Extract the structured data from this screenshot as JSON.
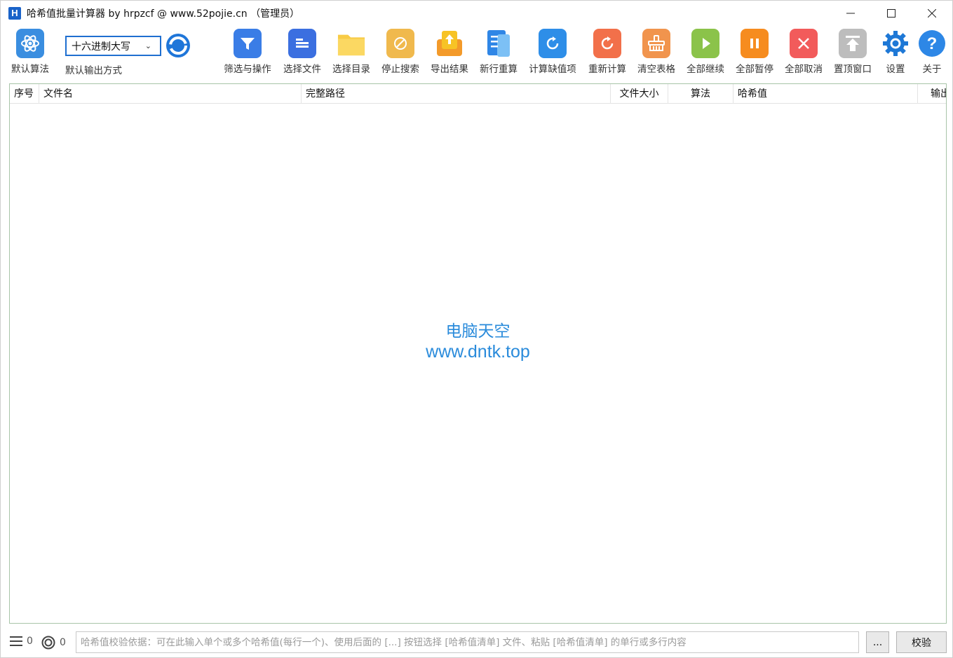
{
  "window": {
    "icon_letter": "H",
    "title": "哈希值批量计算器 by hrpzcf @ www.52pojie.cn （管理员）"
  },
  "toolbar": {
    "default_algorithm": {
      "label": "默认算法",
      "icon": "atom-icon",
      "color": "#3a8ee0"
    },
    "output_mode": {
      "value": "十六进制大写",
      "label": "默认输出方式"
    },
    "refresh": {
      "icon": "circular-refresh-icon",
      "color": "#1f76d9"
    },
    "buttons": [
      {
        "label": "筛选与操作",
        "icon": "filter-icon",
        "color": "#3a7de6"
      },
      {
        "label": "选择文件",
        "icon": "file-list-icon",
        "color": "#3b6fe0"
      },
      {
        "label": "选择目录",
        "icon": "folder-icon",
        "color": "#f8cb45"
      },
      {
        "label": "停止搜索",
        "icon": "stop-search-icon",
        "color": "#f0b94d"
      },
      {
        "label": "导出结果",
        "icon": "export-icon",
        "color": "#f7b825"
      },
      {
        "label": "新行重算",
        "icon": "new-row-recalc-icon",
        "color": "#2f86e6"
      },
      {
        "label": "计算缺值项",
        "icon": "calc-missing-icon",
        "color": "#2e8ee8"
      },
      {
        "label": "重新计算",
        "icon": "recalculate-icon",
        "color": "#f2704a"
      },
      {
        "label": "清空表格",
        "icon": "clear-table-icon",
        "color": "#f1944d"
      },
      {
        "label": "全部继续",
        "icon": "play-icon",
        "color": "#8bc34a"
      },
      {
        "label": "全部暂停",
        "icon": "pause-icon",
        "color": "#f68c1f"
      },
      {
        "label": "全部取消",
        "icon": "cancel-icon",
        "color": "#f25b5b"
      },
      {
        "label": "置顶窗口",
        "icon": "pin-top-icon",
        "color": "#bdbdbd"
      },
      {
        "label": "设置",
        "icon": "gear-icon",
        "color": "#1e78d6"
      },
      {
        "label": "关于",
        "icon": "help-icon",
        "color": "#2d87e6"
      }
    ]
  },
  "table": {
    "columns": [
      "序号",
      "文件名",
      "完整路径",
      "文件大小",
      "算法",
      "哈希值",
      "输出"
    ],
    "rows": []
  },
  "watermark": {
    "line1": "电脑天空",
    "line2": "www.dntk.top"
  },
  "status": {
    "list_count": "0",
    "target_count": "0",
    "verify_placeholder": "哈希值校验依据：可在此输入单个或多个哈希值(每行一个)、使用后面的 [...] 按钮选择 [哈希值清单] 文件、粘贴 [哈希值清单] 的单行或多行内容",
    "browse_label": "...",
    "verify_label": "校验"
  }
}
